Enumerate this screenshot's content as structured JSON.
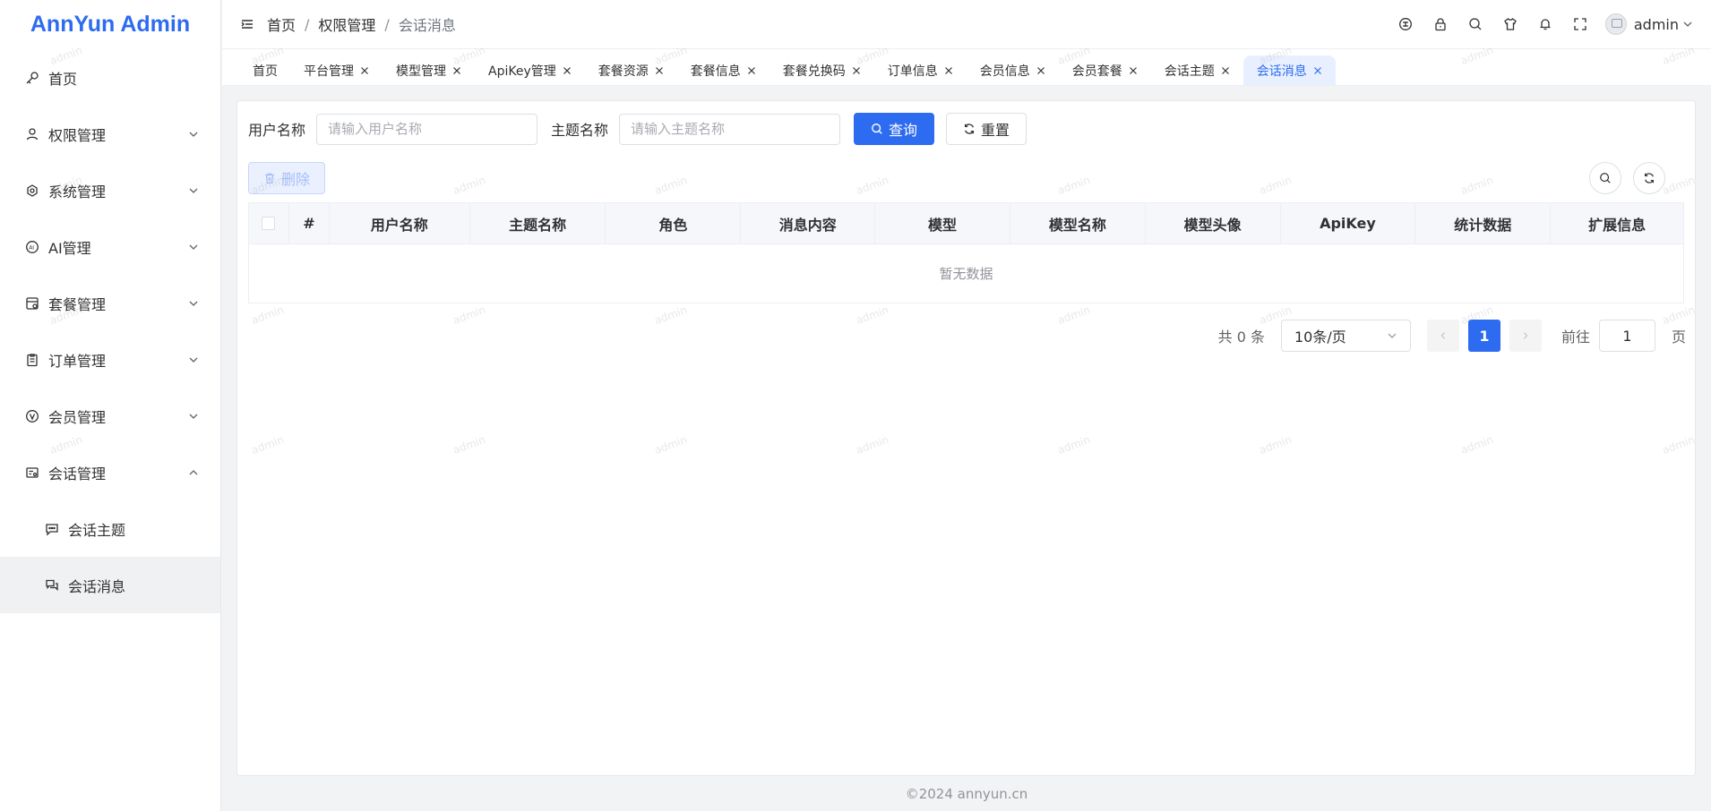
{
  "app": {
    "title": "AnnYun Admin"
  },
  "sidebar": {
    "items": [
      {
        "label": "首页",
        "icon": "key-icon"
      },
      {
        "label": "权限管理",
        "icon": "user-icon"
      },
      {
        "label": "系统管理",
        "icon": "gear-icon"
      },
      {
        "label": "AI管理",
        "icon": "ai-icon"
      },
      {
        "label": "套餐管理",
        "icon": "package-icon"
      },
      {
        "label": "订单管理",
        "icon": "clipboard-icon"
      },
      {
        "label": "会员管理",
        "icon": "vip-icon"
      },
      {
        "label": "会话管理",
        "icon": "chat-manage-icon"
      }
    ],
    "subitems": [
      {
        "label": "会话主题",
        "icon": "chat-topic-icon"
      },
      {
        "label": "会话消息",
        "icon": "chat-message-icon"
      }
    ]
  },
  "header": {
    "breadcrumb": [
      "首页",
      "权限管理",
      "会话消息"
    ],
    "separator": "/",
    "username": "admin"
  },
  "tabs": [
    "首页",
    "平台管理",
    "模型管理",
    "ApiKey管理",
    "套餐资源",
    "套餐信息",
    "套餐兑换码",
    "订单信息",
    "会员信息",
    "会员套餐",
    "会话主题",
    "会话消息"
  ],
  "search": {
    "user_label": "用户名称",
    "user_placeholder": "请输入用户名称",
    "topic_label": "主题名称",
    "topic_placeholder": "请输入主题名称",
    "query_button": "查询",
    "reset_button": "重置"
  },
  "toolbar": {
    "delete_button": "删除"
  },
  "table": {
    "columns": [
      "#",
      "用户名称",
      "主题名称",
      "角色",
      "消息内容",
      "模型",
      "模型名称",
      "模型头像",
      "ApiKey",
      "统计数据",
      "扩展信息"
    ],
    "empty_text": "暂无数据"
  },
  "pagination": {
    "total_text": "共 0 条",
    "page_size": "10条/页",
    "current_page": "1",
    "goto_label": "前往",
    "goto_value": "1",
    "page_suffix": "页"
  },
  "footer": {
    "copyright": "©2024 annyun.cn"
  },
  "watermark": "admin",
  "colors": {
    "primary": "#2d6bf0",
    "active_tab_bg": "#e8f0ff",
    "active_menu_bg": "#f0f1f3"
  }
}
